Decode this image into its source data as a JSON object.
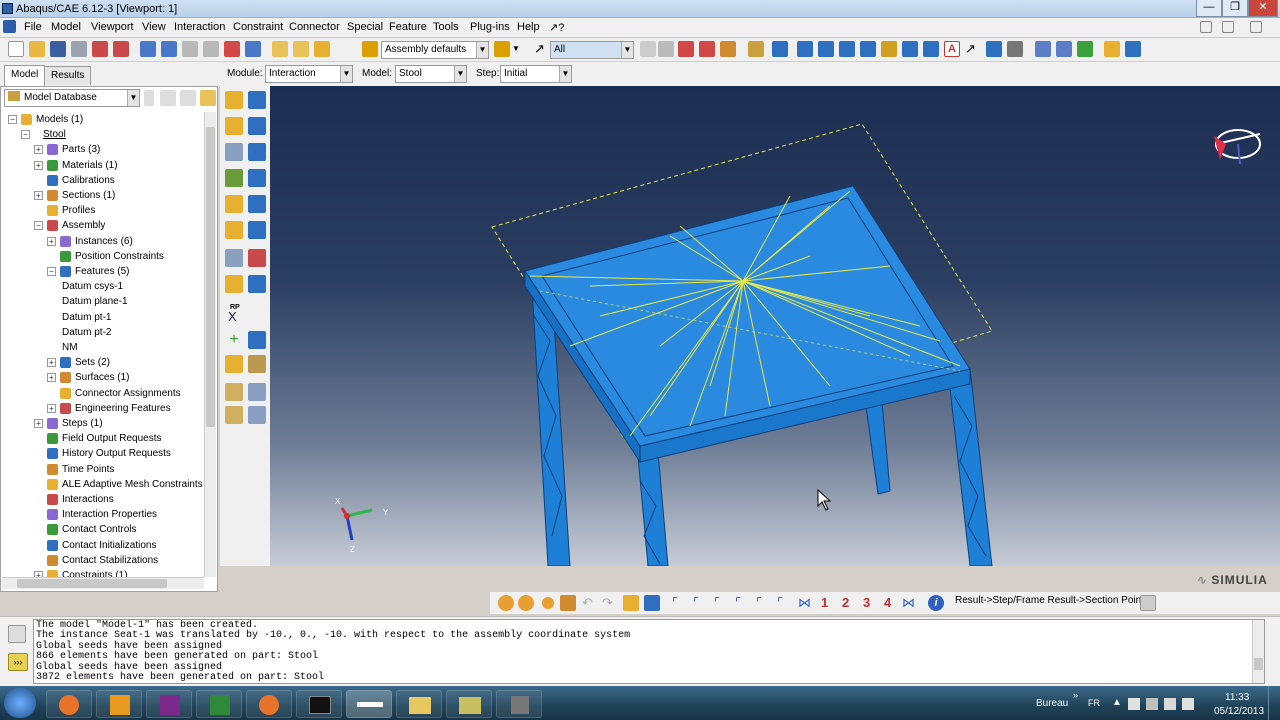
{
  "window": {
    "title": "Abaqus/CAE 6.12-3 [Viewport: 1]"
  },
  "menu": {
    "items": [
      "File",
      "Model",
      "Viewport",
      "View",
      "Interaction",
      "Constraint",
      "Connector",
      "Special",
      "Feature",
      "Tools",
      "Plug-ins",
      "Help",
      "↗?"
    ]
  },
  "toolbar": {
    "assembly_defaults": "Assembly defaults",
    "select_filter": "All"
  },
  "tabs": {
    "model": "Model",
    "results": "Results"
  },
  "context": {
    "module_label": "Module:",
    "module_value": "Interaction",
    "model_label": "Model:",
    "model_value": "Stool",
    "step_label": "Step:",
    "step_value": "Initial"
  },
  "tree": {
    "db_label": "Model Database",
    "rows": [
      {
        "text": "Models (1)",
        "level": 0,
        "exp": "−"
      },
      {
        "text": "Stool",
        "level": 1,
        "exp": "−",
        "underline": true
      },
      {
        "text": "Parts (3)",
        "level": 2,
        "exp": "+"
      },
      {
        "text": "Materials (1)",
        "level": 2,
        "exp": "+"
      },
      {
        "text": "Calibrations",
        "level": 2,
        "exp": ""
      },
      {
        "text": "Sections (1)",
        "level": 2,
        "exp": "+"
      },
      {
        "text": "Profiles",
        "level": 2,
        "exp": ""
      },
      {
        "text": "Assembly",
        "level": 2,
        "exp": "−"
      },
      {
        "text": "Instances (6)",
        "level": 3,
        "exp": "+"
      },
      {
        "text": "Position Constraints",
        "level": 3,
        "exp": ""
      },
      {
        "text": "Features (5)",
        "level": 3,
        "exp": "−"
      },
      {
        "text": "Datum csys-1",
        "level": 4,
        "exp": ""
      },
      {
        "text": "Datum plane-1",
        "level": 4,
        "exp": ""
      },
      {
        "text": "Datum pt-1",
        "level": 4,
        "exp": ""
      },
      {
        "text": "Datum pt-2",
        "level": 4,
        "exp": ""
      },
      {
        "text": "NM",
        "level": 4,
        "exp": ""
      },
      {
        "text": "Sets (2)",
        "level": 3,
        "exp": "+"
      },
      {
        "text": "Surfaces (1)",
        "level": 3,
        "exp": "+"
      },
      {
        "text": "Connector Assignments",
        "level": 3,
        "exp": ""
      },
      {
        "text": "Engineering Features",
        "level": 3,
        "exp": "+"
      },
      {
        "text": "Steps (1)",
        "level": 2,
        "exp": "+"
      },
      {
        "text": "Field Output Requests",
        "level": 2,
        "exp": ""
      },
      {
        "text": "History Output Requests",
        "level": 2,
        "exp": ""
      },
      {
        "text": "Time Points",
        "level": 2,
        "exp": ""
      },
      {
        "text": "ALE Adaptive Mesh Constraints",
        "level": 2,
        "exp": ""
      },
      {
        "text": "Interactions",
        "level": 2,
        "exp": ""
      },
      {
        "text": "Interaction Properties",
        "level": 2,
        "exp": ""
      },
      {
        "text": "Contact Controls",
        "level": 2,
        "exp": ""
      },
      {
        "text": "Contact Initializations",
        "level": 2,
        "exp": ""
      },
      {
        "text": "Contact Stabilizations",
        "level": 2,
        "exp": ""
      },
      {
        "text": "Constraints (1)",
        "level": 2,
        "exp": "+"
      }
    ]
  },
  "viewport": {
    "triad": {
      "x": "X",
      "y": "Y",
      "z": "Z"
    },
    "rp_label": "RP",
    "x_label": "X",
    "brand": "SIMULIA",
    "model_color": "#1e7fd6",
    "edge_color": "#0d3f78",
    "wire_color": "#e8e84a"
  },
  "prompt": {
    "text": "Result->Step/Frame Result->Section Points",
    "nums": [
      "1",
      "2",
      "3",
      "4"
    ]
  },
  "messages": [
    "The model \"Model-1\" has been created.",
    "The instance Seat-1 was translated by -10., 0., -10. with respect to the assembly coordinate system",
    "Global seeds have been assigned",
    "866 elements have been generated on part: Stool",
    "Global seeds have been assigned",
    "3872 elements have been generated on part: Stool"
  ],
  "taskbar": {
    "desktop_label": "Bureau",
    "lang": "FR",
    "time": "11:33",
    "date": "05/12/2013"
  }
}
